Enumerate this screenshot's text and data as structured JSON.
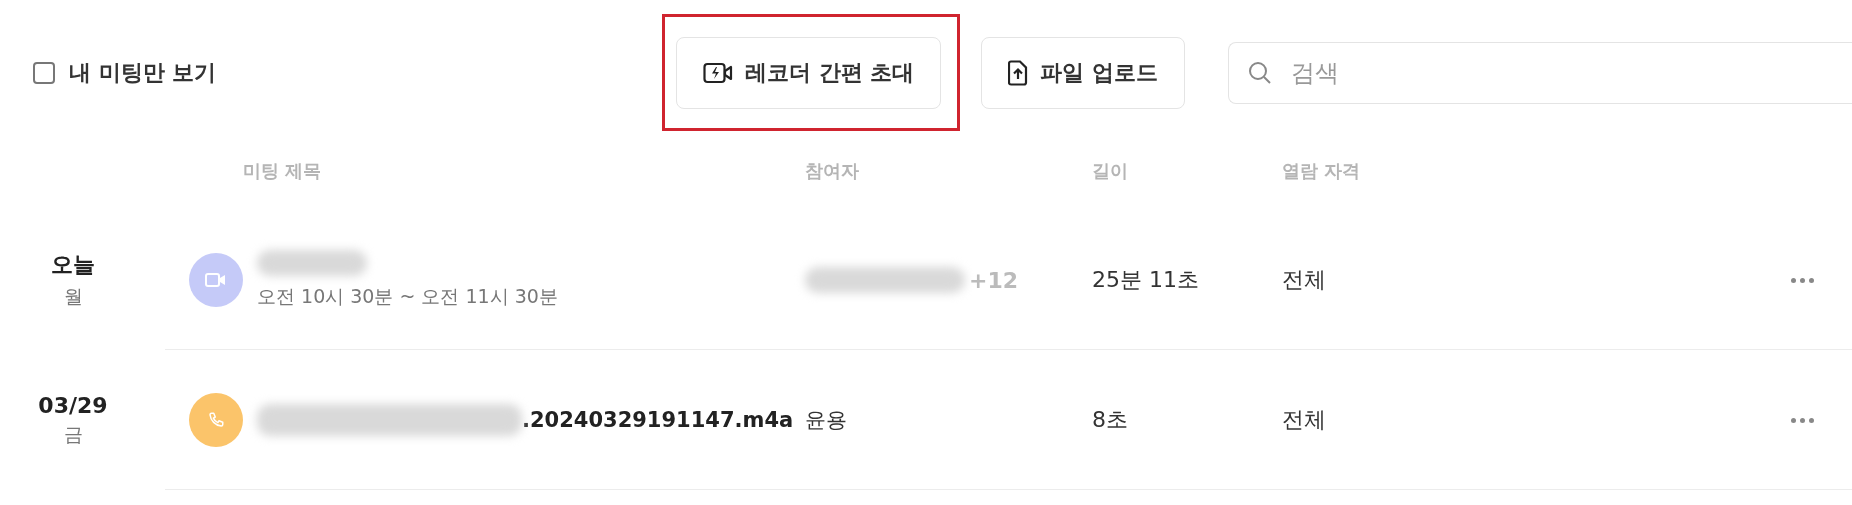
{
  "filter": {
    "label": "내 미팅만 보기",
    "checked": false
  },
  "actions": [
    {
      "kind": "recorder",
      "label": "레코더 간편 초대",
      "highlighted": true
    },
    {
      "kind": "upload",
      "label": "파일 업로드",
      "highlighted": false
    }
  ],
  "search": {
    "placeholder": "검색"
  },
  "table": {
    "columns": [
      "미팅 제목",
      "참여자",
      "길이",
      "열람 자격"
    ],
    "rows": [
      {
        "date": "오늘",
        "weekday": "월",
        "kind": "video",
        "title": "",
        "title_blurred": true,
        "time": "오전 10시 30분 ~ 오전 11시 30분",
        "participants": "",
        "participants_blurred": true,
        "more_participants": "+12",
        "length": "25분 11초",
        "access": "전체"
      },
      {
        "date": "03/29",
        "weekday": "금",
        "kind": "call",
        "title": ".20240329191147.m4a",
        "title_blurred": true,
        "participants": "윤용",
        "participants_blurred": false,
        "length": "8초",
        "access": "전체"
      }
    ]
  }
}
